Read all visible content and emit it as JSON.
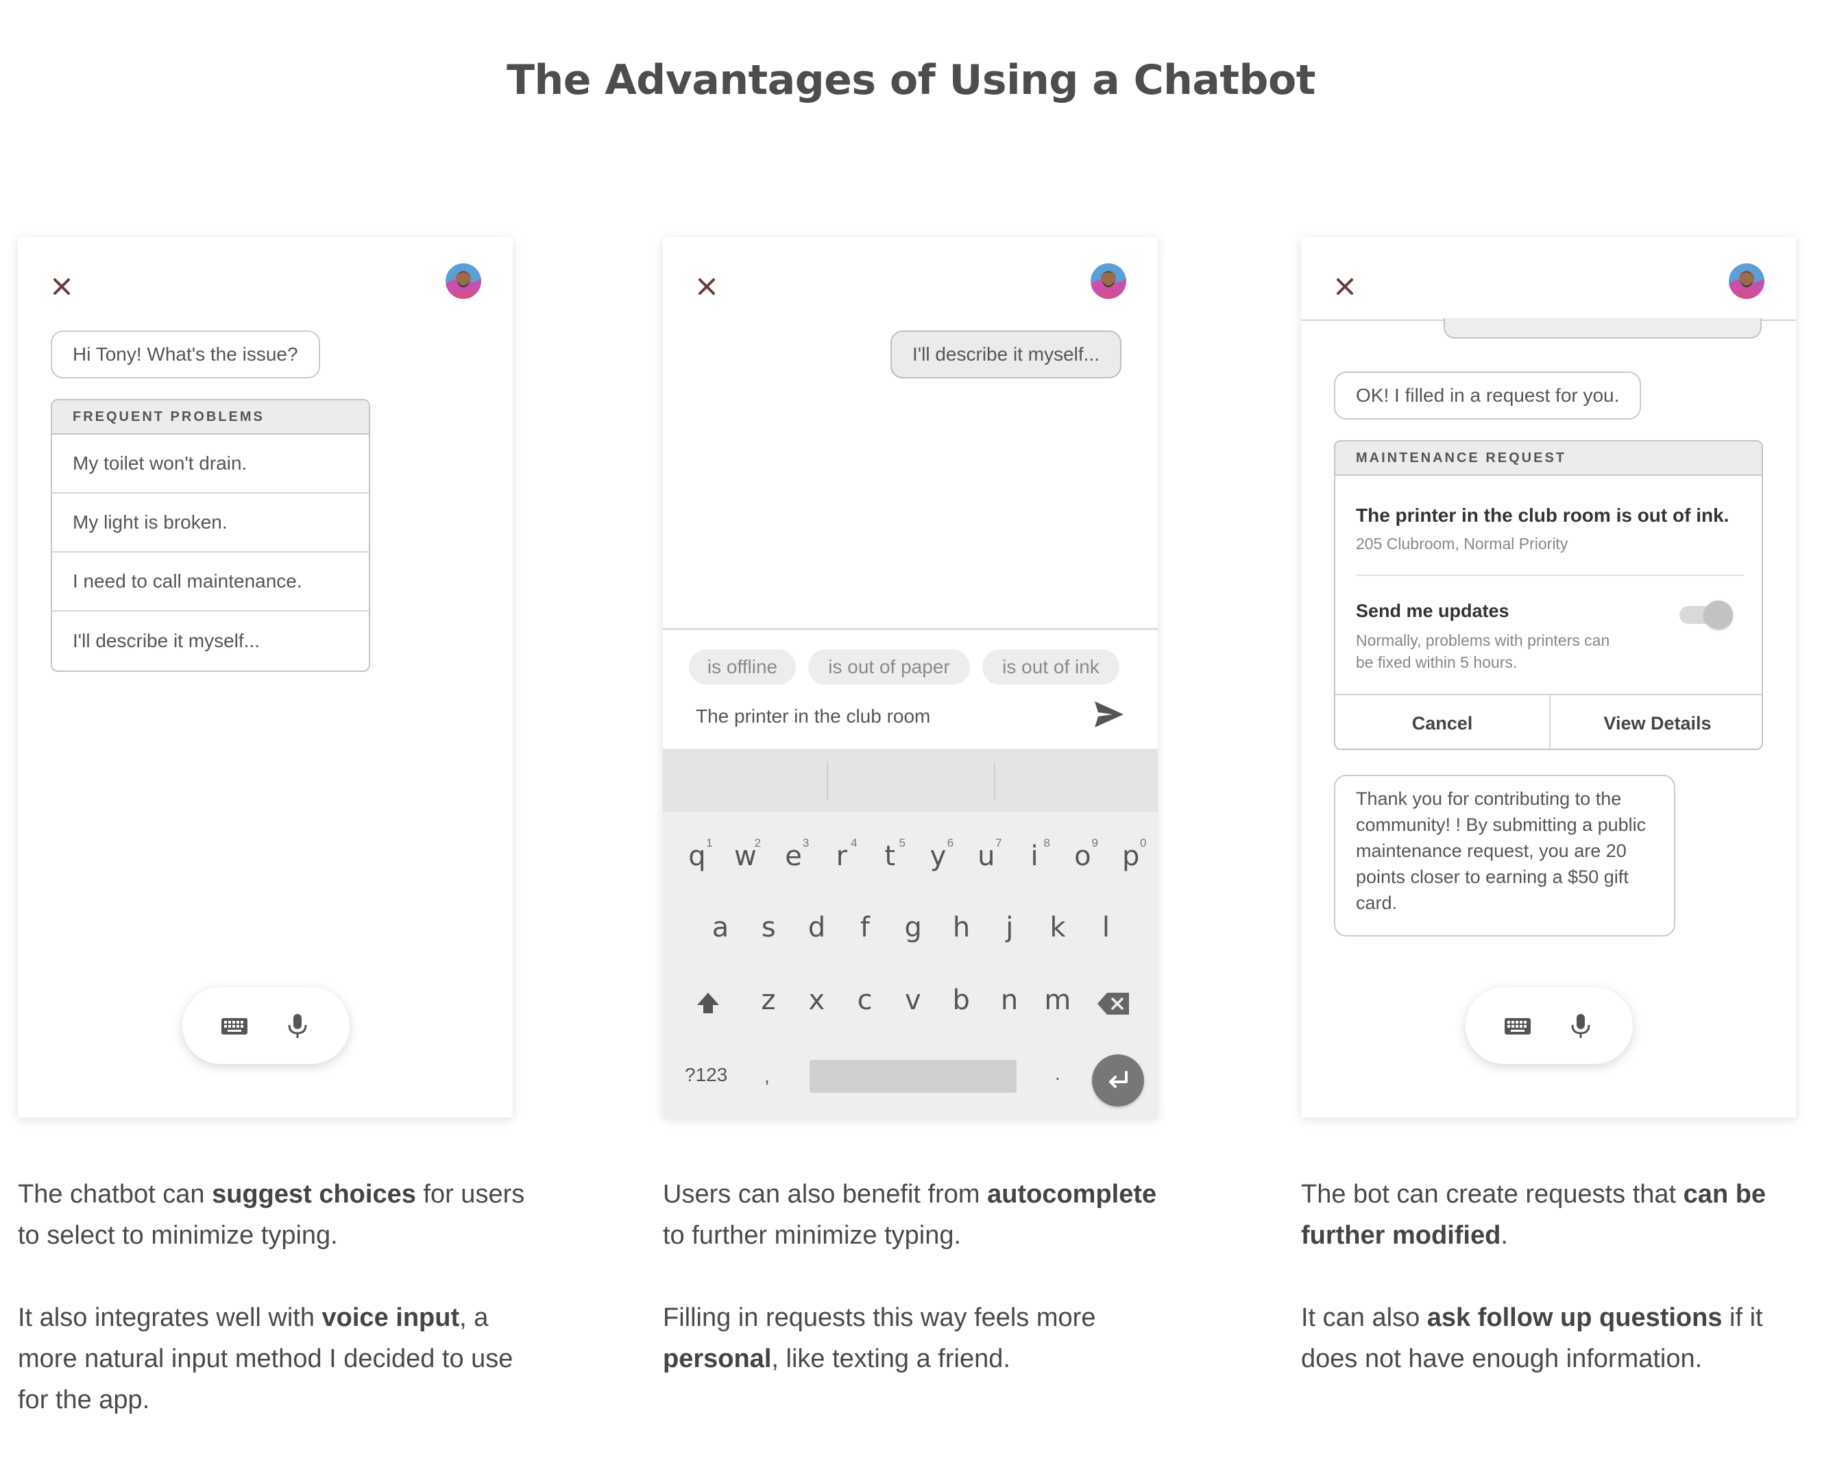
{
  "page": {
    "title": "The Advantages of Using a Chatbot"
  },
  "icons": {
    "close": "close-icon",
    "avatar": "user-avatar",
    "keyboard": "keyboard-icon",
    "mic": "microphone-icon",
    "send": "send-icon",
    "shift": "shift-icon",
    "backspace": "backspace-icon",
    "enter": "enter-icon"
  },
  "colors": {
    "close_x": "#6b3a3a",
    "text": "#4a4a4a",
    "card_border": "#c4c4c4"
  },
  "phone1": {
    "greeting": "Hi Tony! What's the issue?",
    "menu_header": "FREQUENT PROBLEMS",
    "menu_items": [
      "My toilet won't drain.",
      "My light is broken.",
      "I need to call maintenance.",
      "I'll describe it myself..."
    ]
  },
  "phone2": {
    "user_message": "I'll describe it myself...",
    "chips": [
      "is offline",
      "is out of paper",
      "is out of ink"
    ],
    "compose_text": "The printer in the club room",
    "keyboard": {
      "row1": [
        "q",
        "w",
        "e",
        "r",
        "t",
        "y",
        "u",
        "i",
        "o",
        "p"
      ],
      "row1_nums": [
        "1",
        "2",
        "3",
        "4",
        "5",
        "6",
        "7",
        "8",
        "9",
        "0"
      ],
      "row2": [
        "a",
        "s",
        "d",
        "f",
        "g",
        "h",
        "j",
        "k",
        "l"
      ],
      "row3": [
        "z",
        "x",
        "c",
        "v",
        "b",
        "n",
        "m"
      ],
      "symbols_key": "?123",
      "comma": ",",
      "period": "."
    }
  },
  "phone3": {
    "bot_message": "OK! I filled in a request for you.",
    "card_header": "MAINTENANCE REQUEST",
    "request_title": "The printer in the club room is out of ink.",
    "request_sub": "205 Clubroom, Normal Priority",
    "updates_title": "Send me updates",
    "updates_sub": "Normally, problems with printers can be fixed within 5 hours.",
    "cancel_label": "Cancel",
    "details_label": "View Details",
    "thanks_message": "Thank you for contributing to the community! ! By submitting a public maintenance request, you are 20 points closer to earning a $50 gift card."
  },
  "captions": {
    "c1": {
      "p1_a": "The chatbot can ",
      "p1_b": "suggest choices",
      "p1_c": " for users to select to minimize typing.",
      "p2_a": "It also integrates well with ",
      "p2_b": "voice input",
      "p2_c": ", a more natural input method I decided to use for the app."
    },
    "c2": {
      "p1_a": "Users can also benefit from ",
      "p1_b": "autocomplete",
      "p1_c": " to further minimize typing.",
      "p2_a": "Filling in requests this way feels more ",
      "p2_b": "personal",
      "p2_c": ", like texting a friend."
    },
    "c3": {
      "p1_a": "The bot can create requests that ",
      "p1_b": "can be further modified",
      "p1_c": ".",
      "p2_a": "It can also ",
      "p2_b": "ask follow up questions",
      "p2_c": " if it does not have enough information."
    }
  }
}
